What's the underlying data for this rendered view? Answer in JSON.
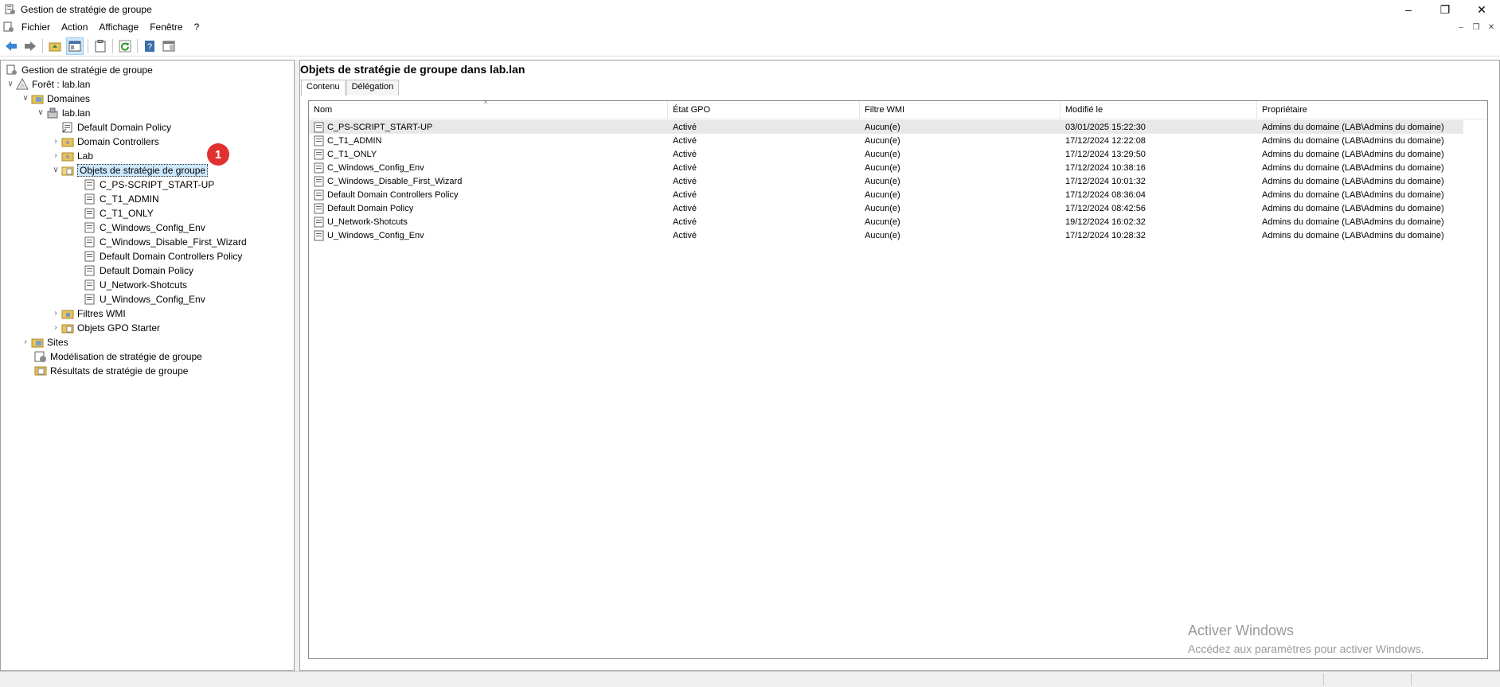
{
  "window": {
    "title": "Gestion de stratégie de groupe"
  },
  "menu": {
    "items": [
      "Fichier",
      "Action",
      "Affichage",
      "Fenêtre",
      "?"
    ]
  },
  "tree": {
    "root": "Gestion de stratégie de groupe",
    "forest": "Forêt : lab.lan",
    "domains": "Domaines",
    "domain": "lab.lan",
    "default_domain_policy": "Default Domain Policy",
    "domain_controllers": "Domain Controllers",
    "lab": "Lab",
    "gpo_container": "Objets de stratégie de groupe",
    "gpos": [
      "C_PS-SCRIPT_START-UP",
      "C_T1_ADMIN",
      "C_T1_ONLY",
      "C_Windows_Config_Env",
      "C_Windows_Disable_First_Wizard",
      "Default Domain Controllers Policy",
      "Default Domain Policy",
      "U_Network-Shotcuts",
      "U_Windows_Config_Env"
    ],
    "wmi_filters": "Filtres WMI",
    "starter_gpos": "Objets GPO Starter",
    "sites": "Sites",
    "modeling": "Modélisation de stratégie de groupe",
    "results": "Résultats de stratégie de groupe"
  },
  "annotation": {
    "badge": "1"
  },
  "content": {
    "title": "Objets de stratégie de groupe dans lab.lan",
    "tabs": [
      "Contenu",
      "Délégation"
    ],
    "columns": [
      "Nom",
      "État GPO",
      "Filtre WMI",
      "Modifié le",
      "Propriétaire"
    ],
    "rows": [
      [
        "C_PS-SCRIPT_START-UP",
        "Activé",
        "Aucun(e)",
        "03/01/2025 15:22:30",
        "Admins du domaine (LAB\\Admins du domaine)"
      ],
      [
        "C_T1_ADMIN",
        "Activé",
        "Aucun(e)",
        "17/12/2024 12:22:08",
        "Admins du domaine (LAB\\Admins du domaine)"
      ],
      [
        "C_T1_ONLY",
        "Activé",
        "Aucun(e)",
        "17/12/2024 13:29:50",
        "Admins du domaine (LAB\\Admins du domaine)"
      ],
      [
        "C_Windows_Config_Env",
        "Activé",
        "Aucun(e)",
        "17/12/2024 10:38:16",
        "Admins du domaine (LAB\\Admins du domaine)"
      ],
      [
        "C_Windows_Disable_First_Wizard",
        "Activé",
        "Aucun(e)",
        "17/12/2024 10:01:32",
        "Admins du domaine (LAB\\Admins du domaine)"
      ],
      [
        "Default Domain Controllers Policy",
        "Activé",
        "Aucun(e)",
        "17/12/2024 08:36:04",
        "Admins du domaine (LAB\\Admins du domaine)"
      ],
      [
        "Default Domain Policy",
        "Activé",
        "Aucun(e)",
        "17/12/2024 08:42:56",
        "Admins du domaine (LAB\\Admins du domaine)"
      ],
      [
        "U_Network-Shotcuts",
        "Activé",
        "Aucun(e)",
        "19/12/2024 16:02:32",
        "Admins du domaine (LAB\\Admins du domaine)"
      ],
      [
        "U_Windows_Config_Env",
        "Activé",
        "Aucun(e)",
        "17/12/2024 10:28:32",
        "Admins du domaine (LAB\\Admins du domaine)"
      ]
    ]
  },
  "watermark": {
    "line1": "Activer Windows",
    "line2": "Accédez aux paramètres pour activer Windows."
  },
  "icons": {
    "gpo": "gpo-icon",
    "folder": "folder-icon",
    "domain": "domain-icon",
    "forest": "forest-icon"
  },
  "colors": {
    "selection": "#cce8ff",
    "badge": "#e03030",
    "watermark": "#9a9a9a"
  }
}
